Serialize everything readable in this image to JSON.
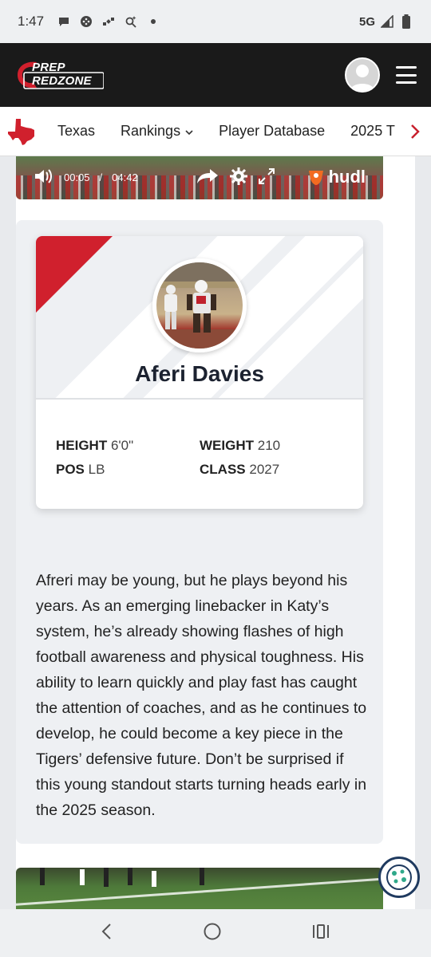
{
  "status_bar": {
    "time": "1:47",
    "network": "5G",
    "icons": [
      "chat-bubble-icon",
      "game-controller-icon",
      "satellite-icon",
      "search-sparkle-icon",
      "dot-icon",
      "signal-icon",
      "battery-icon"
    ]
  },
  "header": {
    "logo_line1": "PREP",
    "logo_line2": "REDZONE",
    "brand_color": "#d0202d",
    "avatar_icon": "user-avatar-icon",
    "menu_icon": "hamburger-menu-icon"
  },
  "nav": {
    "state_icon": "texas-state-icon",
    "items": [
      {
        "label": "Texas"
      },
      {
        "label": "Rankings"
      },
      {
        "label": "Player Database"
      },
      {
        "label": "2025 T"
      }
    ],
    "next_icon": "chevron-right-icon"
  },
  "video_top": {
    "current_time": "00:05",
    "separator": "/",
    "duration": "04:42",
    "brand": "hudl",
    "progress": 0.018
  },
  "player": {
    "name": "Aferi Davies",
    "stats": [
      {
        "key": "HEIGHT",
        "value": "6'0\""
      },
      {
        "key": "WEIGHT",
        "value": "210"
      },
      {
        "key": "POS",
        "value": "LB"
      },
      {
        "key": "CLASS",
        "value": "2027"
      }
    ]
  },
  "bio": "Afreri may be young, but he plays beyond his years. As an emerging linebacker in Katy’s system, he’s already showing flashes of high football awareness and physical toughness. His ability to learn quickly and play fast has caught the attention of coaches, and as he continues to develop, he could become a key piece in the Tigers’ defensive future. Don’t be surprised if this young standout starts turning heads early in the 2025 season.",
  "cookie_icon": "cookie-icon",
  "system_nav": {
    "back_icon": "back-chevron-icon",
    "home_icon": "home-circle-icon",
    "recents_icon": "recents-icon"
  }
}
